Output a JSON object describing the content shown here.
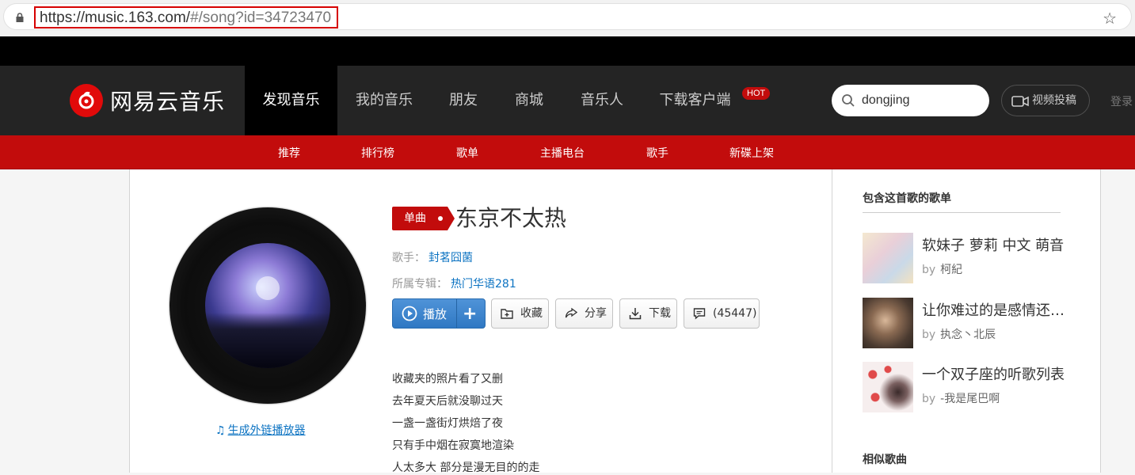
{
  "browser": {
    "url_host": "https://music.163.com/",
    "url_path": "#/song?id=34723470"
  },
  "topnav": {
    "logo_text": "网易云音乐",
    "items": [
      "发现音乐",
      "我的音乐",
      "朋友",
      "商城",
      "音乐人",
      "下载客户端"
    ],
    "hot_badge": "HOT",
    "search_value": "dongjing",
    "upload_label": "视频投稿",
    "login_label": "登录"
  },
  "subnav": {
    "items": [
      "推荐",
      "排行榜",
      "歌单",
      "主播电台",
      "歌手",
      "新碟上架"
    ]
  },
  "song": {
    "badge": "单曲",
    "title": "东京不太热",
    "artist_label": "歌手：",
    "artist": "封茗囧菌",
    "album_label": "所属专辑：",
    "album": "热门华语281",
    "gen_link": "生成外链播放器"
  },
  "actions": {
    "play": "播放",
    "collect": "收藏",
    "share": "分享",
    "download": "下载",
    "comment": "(45447)"
  },
  "lyrics": [
    "收藏夹的照片看了又删",
    "去年夏天后就没聊过天",
    "一盏一盏街灯烘焙了夜",
    "只有手中烟在寂寞地渲染",
    "人太多大 部分是漫无目的的走"
  ],
  "sidebar": {
    "playlists_heading": "包含这首歌的歌单",
    "by_label": "by",
    "playlists": [
      {
        "title": "软妹子 萝莉 中文 萌音",
        "author": "柯紀"
      },
      {
        "title": "让你难过的是感情还是自己",
        "author": "执念丶北辰"
      },
      {
        "title": "一个双子座的听歌列表",
        "author": "-我是尾巴啊"
      }
    ],
    "similar_heading": "相似歌曲"
  },
  "colors": {
    "brand_red": "#c20c0c",
    "nav_bg": "#242424",
    "link_blue": "#0c73c2"
  }
}
